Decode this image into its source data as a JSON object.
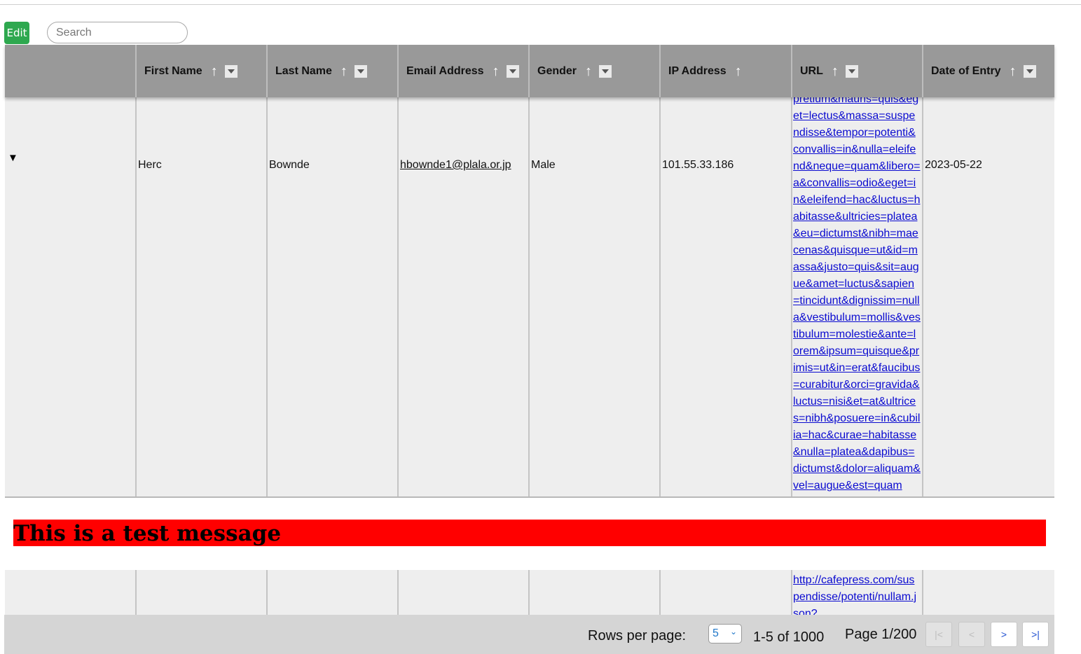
{
  "toolbar": {
    "edit_label": "Edit",
    "search_placeholder": "Search",
    "edit_color": "#2ea84f"
  },
  "columns": [
    {
      "label": "",
      "sortable": false,
      "filterable": false
    },
    {
      "label": "First Name",
      "sort_icon": "↑",
      "filterable": true
    },
    {
      "label": "Last Name",
      "sort_icon": "↑",
      "filterable": true
    },
    {
      "label": "Email Address",
      "sort_icon": "↑",
      "filterable": true
    },
    {
      "label": "Gender",
      "sort_icon": "↑",
      "filterable": true
    },
    {
      "label": "IP Address",
      "sort_icon": "↑",
      "filterable": false
    },
    {
      "label": "URL",
      "sort_icon": "↑",
      "filterable": true
    },
    {
      "label": "Date of Entry",
      "sort_icon": "↑",
      "filterable": true
    }
  ],
  "rows": [
    {
      "expander": "▼",
      "first_name": "Herc",
      "last_name": "Bownde",
      "email": "hbownde1@plala.or.jp",
      "gender": "Male",
      "ip": "101.55.33.186",
      "url_visible": "pretium&mauris=quis&eget=lectus&massa=suspendisse&tempor=potenti&convallis=in&nulla=eleifend&neque=quam&libero=a&convallis=odio&eget=in&eleifend=hac&luctus=habitasse&ultricies=platea&eu=dictumst&nibh=maecenas&quisque=ut&id=massa&justo=quis&sit=augue&amet=luctus&sapien=tincidunt&dignissim=nulla&vestibulum=mollis&vestibulum=molestie&ante=lorem&ipsum=quisque&primis=ut&in=erat&faucibus=curabitur&orci=gravida&luctus=nisi&et=at&ultrices=nibh&posuere=in&cubilia=hac&curae=habitasse&nulla=platea&dapibus=dictumst&dolor=aliquam&vel=augue&est=quam",
      "date": "2023-05-22"
    },
    {
      "url_visible": "http://cafepress.com/suspendisse/potenti/nullam.json?"
    }
  ],
  "banner": {
    "message": "This is a test message",
    "color": "#ff0000"
  },
  "pagination": {
    "rows_per_page_label": "Rows per page:",
    "rows_per_page_value": "5",
    "range_text": "1-5 of 1000",
    "page_text": "Page 1/200",
    "first_label": "|<",
    "prev_label": "<",
    "next_label": ">",
    "last_label": ">|"
  }
}
